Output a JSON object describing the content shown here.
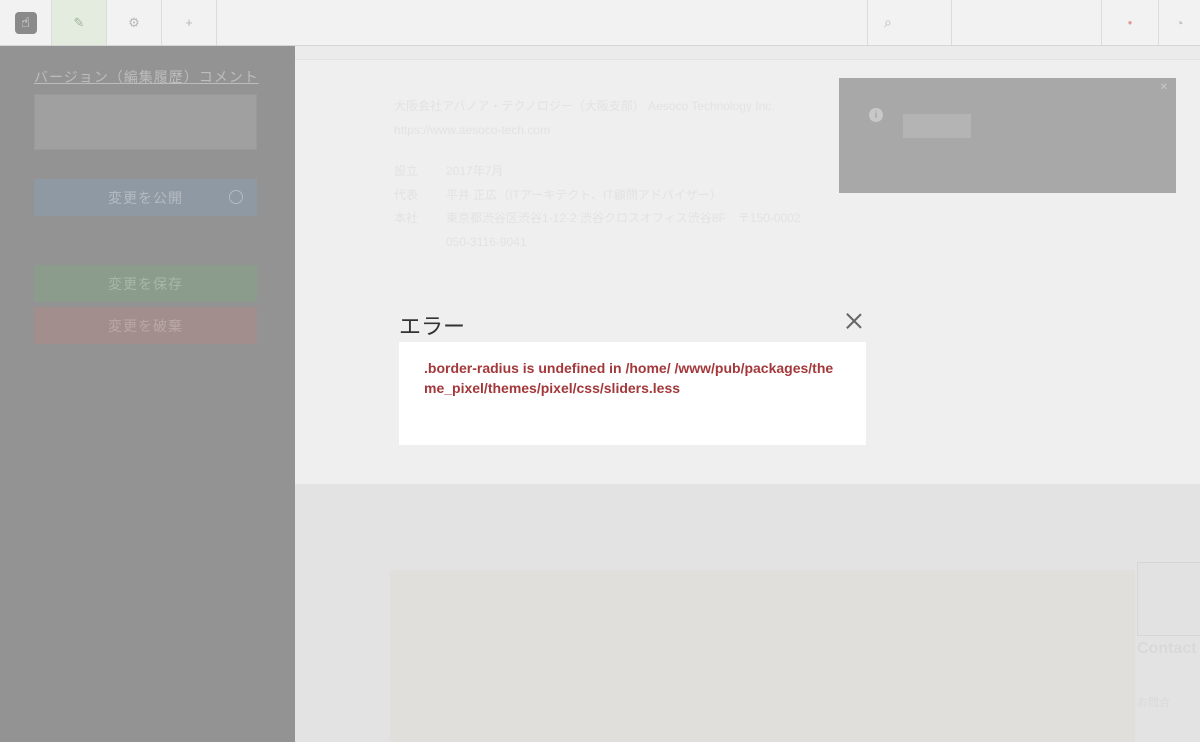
{
  "toolbar": {
    "logo_glyph": "☝",
    "edit_icon": "✎",
    "settings_icon": "⚙",
    "add_icon": "+",
    "search_icon": "⌕",
    "status_dot": "●",
    "help_icon": "◔"
  },
  "sidebar": {
    "version_comment_label": "バージョン（編集履歴）コメント",
    "publish_label": "変更を公開",
    "save_label": "変更を保存",
    "discard_label": "変更を破棄"
  },
  "main": {
    "company_name": "大阪会社アバノア・テクノロジー（大阪支部） Aesoco Technology Inc.",
    "company_url": "https://www.aesoco-tech.com",
    "rows": [
      {
        "key": "設立",
        "value": "2017年7月"
      },
      {
        "key": "代表",
        "value": "平井 正広（ITアーキテクト、IT顧問アドバイザー）"
      },
      {
        "key": "本社",
        "value": "東京都渋谷区渋谷1-12-2 渋谷クロスオフィス渋谷8F　〒150-0002"
      },
      {
        "key": "",
        "value": "050-3116-9041"
      }
    ],
    "contact_label": "Contact",
    "contact_small": "お問合"
  },
  "notice": {
    "info_icon": "i",
    "close_icon": "✕"
  },
  "modal": {
    "title": "エラー",
    "message": ".border-radius is undefined in /home/            /www/pub/packages/theme_pixel/themes/pixel/css/sliders.less"
  }
}
